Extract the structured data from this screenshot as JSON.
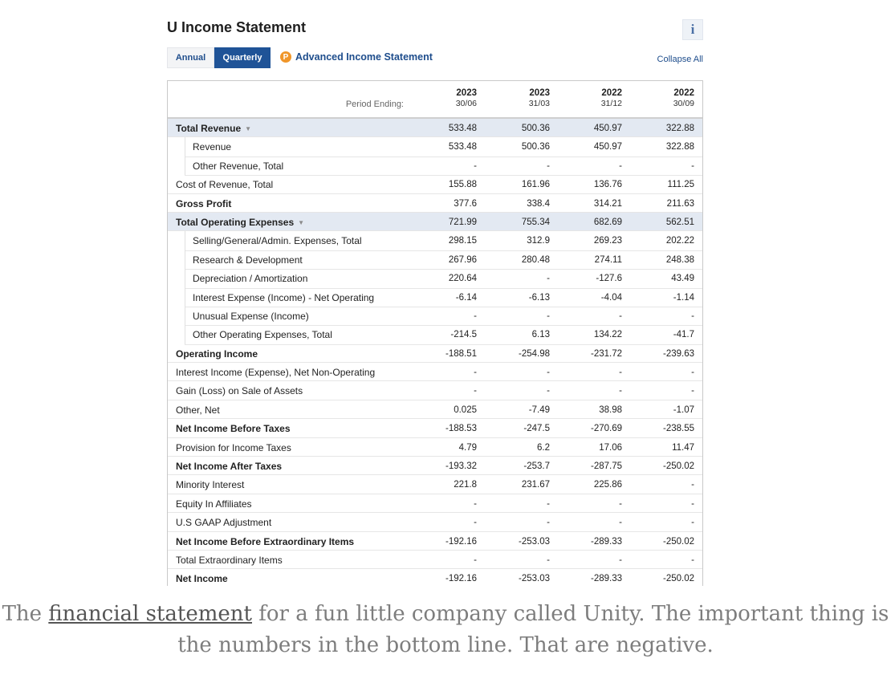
{
  "title": "U Income Statement",
  "info_icon": "i",
  "tabs": {
    "annual": "Annual",
    "quarterly": "Quarterly"
  },
  "advanced": {
    "icon": "P",
    "label": "Advanced Income Statement"
  },
  "collapse_all": "Collapse All",
  "table": {
    "period_label": "Period Ending:",
    "columns": [
      {
        "year": "2023",
        "date": "30/06"
      },
      {
        "year": "2023",
        "date": "31/03"
      },
      {
        "year": "2022",
        "date": "31/12"
      },
      {
        "year": "2022",
        "date": "30/09"
      }
    ],
    "rows": [
      {
        "label": "Total Revenue",
        "style": "section",
        "chevron": true,
        "values": [
          "533.48",
          "500.36",
          "450.97",
          "322.88"
        ]
      },
      {
        "label": "Revenue",
        "style": "sub",
        "values": [
          "533.48",
          "500.36",
          "450.97",
          "322.88"
        ]
      },
      {
        "label": "Other Revenue, Total",
        "style": "sub",
        "values": [
          "-",
          "-",
          "-",
          "-"
        ]
      },
      {
        "label": "Cost of Revenue, Total",
        "style": "normal",
        "values": [
          "155.88",
          "161.96",
          "136.76",
          "111.25"
        ]
      },
      {
        "label": "Gross Profit",
        "style": "bold",
        "values": [
          "377.6",
          "338.4",
          "314.21",
          "211.63"
        ]
      },
      {
        "label": "Total Operating Expenses",
        "style": "section",
        "chevron": true,
        "values": [
          "721.99",
          "755.34",
          "682.69",
          "562.51"
        ]
      },
      {
        "label": "Selling/General/Admin. Expenses, Total",
        "style": "sub",
        "values": [
          "298.15",
          "312.9",
          "269.23",
          "202.22"
        ]
      },
      {
        "label": "Research & Development",
        "style": "sub",
        "values": [
          "267.96",
          "280.48",
          "274.11",
          "248.38"
        ]
      },
      {
        "label": "Depreciation / Amortization",
        "style": "sub",
        "values": [
          "220.64",
          "-",
          "-127.6",
          "43.49"
        ]
      },
      {
        "label": "Interest Expense (Income) - Net Operating",
        "style": "sub",
        "values": [
          "-6.14",
          "-6.13",
          "-4.04",
          "-1.14"
        ]
      },
      {
        "label": "Unusual Expense (Income)",
        "style": "sub",
        "values": [
          "-",
          "-",
          "-",
          "-"
        ]
      },
      {
        "label": "Other Operating Expenses, Total",
        "style": "sub",
        "values": [
          "-214.5",
          "6.13",
          "134.22",
          "-41.7"
        ]
      },
      {
        "label": "Operating Income",
        "style": "bold",
        "values": [
          "-188.51",
          "-254.98",
          "-231.72",
          "-239.63"
        ]
      },
      {
        "label": "Interest Income (Expense), Net Non-Operating",
        "style": "normal",
        "values": [
          "-",
          "-",
          "-",
          "-"
        ]
      },
      {
        "label": "Gain (Loss) on Sale of Assets",
        "style": "normal",
        "values": [
          "-",
          "-",
          "-",
          "-"
        ]
      },
      {
        "label": "Other, Net",
        "style": "normal",
        "values": [
          "0.025",
          "-7.49",
          "38.98",
          "-1.07"
        ]
      },
      {
        "label": "Net Income Before Taxes",
        "style": "bold",
        "values": [
          "-188.53",
          "-247.5",
          "-270.69",
          "-238.55"
        ]
      },
      {
        "label": "Provision for Income Taxes",
        "style": "normal",
        "values": [
          "4.79",
          "6.2",
          "17.06",
          "11.47"
        ]
      },
      {
        "label": "Net Income After Taxes",
        "style": "bold",
        "values": [
          "-193.32",
          "-253.7",
          "-287.75",
          "-250.02"
        ]
      },
      {
        "label": "Minority Interest",
        "style": "normal",
        "values": [
          "221.8",
          "231.67",
          "225.86",
          "-"
        ]
      },
      {
        "label": "Equity In Affiliates",
        "style": "normal",
        "values": [
          "-",
          "-",
          "-",
          "-"
        ]
      },
      {
        "label": "U.S GAAP Adjustment",
        "style": "normal",
        "values": [
          "-",
          "-",
          "-",
          "-"
        ]
      },
      {
        "label": "Net Income Before Extraordinary Items",
        "style": "bold",
        "values": [
          "-192.16",
          "-253.03",
          "-289.33",
          "-250.02"
        ]
      },
      {
        "label": "Total Extraordinary Items",
        "style": "normal",
        "values": [
          "-",
          "-",
          "-",
          "-"
        ]
      },
      {
        "label": "Net Income",
        "style": "bold",
        "values": [
          "-192.16",
          "-253.03",
          "-289.33",
          "-250.02"
        ]
      }
    ]
  },
  "caption": {
    "before": "The ",
    "link": "financial statement",
    "after": " for a fun little company called Unity. The important thing is the numbers in the bottom line. That are negative."
  }
}
